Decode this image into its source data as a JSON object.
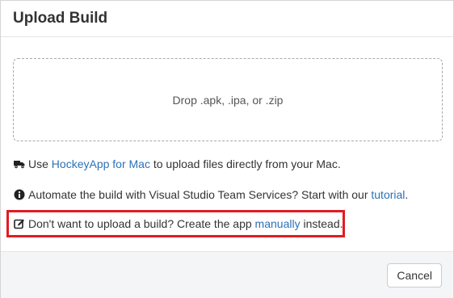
{
  "dialog": {
    "title": "Upload Build"
  },
  "dropzone": {
    "text": "Drop .apk, .ipa, or .zip"
  },
  "info_lines": {
    "mac": {
      "icon": "truck-icon",
      "prefix": "Use ",
      "link": "HockeyApp for Mac",
      "suffix": " to upload files directly from your Mac."
    },
    "vsts": {
      "icon": "info-circle-icon",
      "prefix": "Automate the build with Visual Studio Team Services? Start with our ",
      "link": "tutorial",
      "suffix": "."
    },
    "manual": {
      "icon": "edit-icon",
      "prefix": "Don't want to upload a build? Create the app ",
      "link": "manually",
      "suffix": " instead."
    }
  },
  "highlight": {
    "color": "#e21b23"
  },
  "footer": {
    "cancel_label": "Cancel"
  },
  "colors": {
    "link": "#2a72b8",
    "text": "#333333",
    "footer_bg": "#f4f5f7"
  }
}
